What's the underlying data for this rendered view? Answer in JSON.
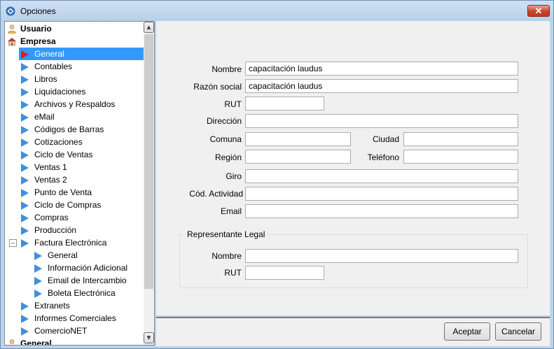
{
  "window": {
    "title": "Opciones",
    "close_symbol": "✕"
  },
  "tree": {
    "items": [
      {
        "label": "Usuario",
        "kind": "top",
        "icon": "user-icon"
      },
      {
        "label": "Empresa",
        "kind": "top",
        "icon": "company-icon"
      },
      {
        "label": "General",
        "kind": "child",
        "selected": true
      },
      {
        "label": "Contables",
        "kind": "child"
      },
      {
        "label": "Libros",
        "kind": "child"
      },
      {
        "label": "Liquidaciones",
        "kind": "child"
      },
      {
        "label": "Archivos y Respaldos",
        "kind": "child"
      },
      {
        "label": "eMail",
        "kind": "child"
      },
      {
        "label": "Códigos de Barras",
        "kind": "child"
      },
      {
        "label": "Cotizaciones",
        "kind": "child"
      },
      {
        "label": "Ciclo de Ventas",
        "kind": "child"
      },
      {
        "label": "Ventas 1",
        "kind": "child"
      },
      {
        "label": "Ventas 2",
        "kind": "child"
      },
      {
        "label": "Punto de Venta",
        "kind": "child"
      },
      {
        "label": "Ciclo de Compras",
        "kind": "child"
      },
      {
        "label": "Compras",
        "kind": "child"
      },
      {
        "label": "Producción",
        "kind": "child"
      },
      {
        "label": "Factura Electrónica",
        "kind": "child",
        "expander": "⊟"
      },
      {
        "label": "General",
        "kind": "grandchild"
      },
      {
        "label": "Información Adicional",
        "kind": "grandchild"
      },
      {
        "label": "Email de Intercambio",
        "kind": "grandchild"
      },
      {
        "label": "Boleta Electrónica",
        "kind": "grandchild"
      },
      {
        "label": "Extranets",
        "kind": "child"
      },
      {
        "label": "Informes Comerciales",
        "kind": "child"
      },
      {
        "label": "ComercioNET",
        "kind": "child"
      },
      {
        "label": "General",
        "kind": "top",
        "icon": "user-icon"
      }
    ],
    "scroll_up": "▲",
    "scroll_down": "▼"
  },
  "form": {
    "nombre_label": "Nombre",
    "nombre_value": "capacitación laudus",
    "razon_label": "Razón social",
    "razon_value": "capacitación laudus",
    "rut_label": "RUT",
    "rut_value": "",
    "direccion_label": "Dirección",
    "direccion_value": "",
    "comuna_label": "Comuna",
    "comuna_value": "",
    "ciudad_label": "Ciudad",
    "ciudad_value": "",
    "region_label": "Región",
    "region_value": "",
    "telefono_label": "Teléfono",
    "telefono_value": "",
    "giro_label": "Giro",
    "giro_value": "",
    "actividad_label": "Cód. Actividad",
    "actividad_value": "",
    "email_label": "Email",
    "email_value": ""
  },
  "representante": {
    "title": "Representante Legal",
    "nombre_label": "Nombre",
    "nombre_value": "",
    "rut_label": "RUT",
    "rut_value": ""
  },
  "buttons": {
    "accept": "Aceptar",
    "cancel": "Cancelar"
  }
}
